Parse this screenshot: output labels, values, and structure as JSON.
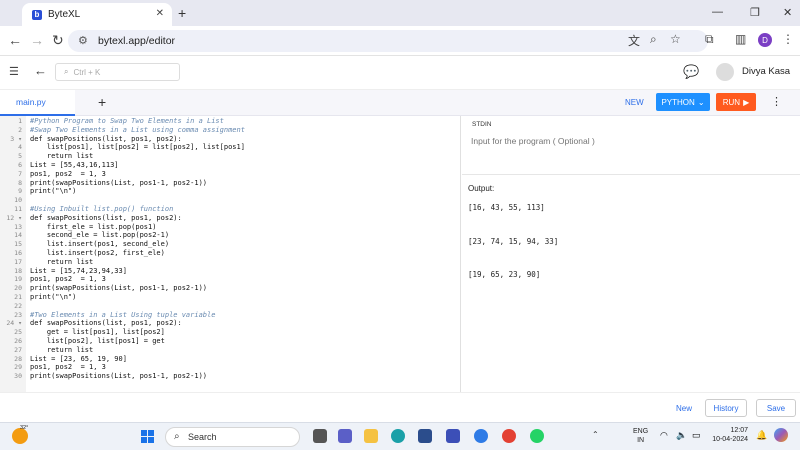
{
  "browser": {
    "tab_title": "ByteXL",
    "url": "bytexl.app/editor"
  },
  "app": {
    "search_placeholder": "Ctrl + K",
    "user_name": "Divya Kasa",
    "avatar_initial": "D"
  },
  "toolbar": {
    "file_tab": "main.py",
    "new_label": "NEW",
    "language_label": "PYTHON",
    "run_label": "RUN"
  },
  "editor": {
    "lines": [
      {
        "n": "1",
        "text": "#Python Program to Swap Two Elements in a List",
        "cls": "cm"
      },
      {
        "n": "2",
        "text": "#Swap Two Elements in a List using comma assignment",
        "cls": "cm"
      },
      {
        "n": "3 ▾",
        "text": "def swapPositions(list, pos1, pos2):",
        "cls": "kw"
      },
      {
        "n": "4",
        "text": "    list[pos1], list[pos2] = list[pos2], list[pos1]",
        "cls": ""
      },
      {
        "n": "5",
        "text": "    return list",
        "cls": ""
      },
      {
        "n": "6",
        "text": "List = [55,43,16,113]",
        "cls": ""
      },
      {
        "n": "7",
        "text": "pos1, pos2  = 1, 3",
        "cls": ""
      },
      {
        "n": "8",
        "text": "print(swapPositions(List, pos1-1, pos2-1))",
        "cls": ""
      },
      {
        "n": "9",
        "text": "print(\"\\n\")",
        "cls": ""
      },
      {
        "n": "10",
        "text": "",
        "cls": ""
      },
      {
        "n": "11",
        "text": "#Using Inbuilt list.pop() function",
        "cls": "cm"
      },
      {
        "n": "12 ▾",
        "text": "def swapPositions(list, pos1, pos2):",
        "cls": "kw"
      },
      {
        "n": "13",
        "text": "    first_ele = list.pop(pos1)",
        "cls": ""
      },
      {
        "n": "14",
        "text": "    second_ele = list.pop(pos2-1)",
        "cls": ""
      },
      {
        "n": "15",
        "text": "    list.insert(pos1, second_ele)",
        "cls": ""
      },
      {
        "n": "16",
        "text": "    list.insert(pos2, first_ele)",
        "cls": ""
      },
      {
        "n": "17",
        "text": "    return list",
        "cls": ""
      },
      {
        "n": "18",
        "text": "List = [15,74,23,94,33]",
        "cls": ""
      },
      {
        "n": "19",
        "text": "pos1, pos2  = 1, 3",
        "cls": ""
      },
      {
        "n": "20",
        "text": "print(swapPositions(List, pos1-1, pos2-1))",
        "cls": ""
      },
      {
        "n": "21",
        "text": "print(\"\\n\")",
        "cls": ""
      },
      {
        "n": "22",
        "text": "",
        "cls": ""
      },
      {
        "n": "23",
        "text": "#Two Elements in a List Using tuple variable",
        "cls": "cm"
      },
      {
        "n": "24 ▾",
        "text": "def swapPositions(list, pos1, pos2):",
        "cls": "kw"
      },
      {
        "n": "25",
        "text": "    get = list[pos1], list[pos2]",
        "cls": ""
      },
      {
        "n": "26",
        "text": "    list[pos2], list[pos1] = get",
        "cls": ""
      },
      {
        "n": "27",
        "text": "    return list",
        "cls": ""
      },
      {
        "n": "28",
        "text": "List = [23, 65, 19, 90]",
        "cls": ""
      },
      {
        "n": "29",
        "text": "pos1, pos2  = 1, 3",
        "cls": ""
      },
      {
        "n": "30",
        "text": "print(swapPositions(List, pos1-1, pos2-1))",
        "cls": ""
      }
    ]
  },
  "stdin": {
    "label": "STDIN",
    "placeholder": "Input for the program ( Optional )"
  },
  "output": {
    "label": "Output:",
    "lines": [
      "[16, 43, 55, 113]",
      "[23, 74, 15, 94, 33]",
      "[19, 65, 23, 90]"
    ]
  },
  "bottom": {
    "new_label": "New",
    "history_label": "History",
    "save_label": "Save"
  },
  "taskbar": {
    "temperature": "32°",
    "search_label": "Search",
    "lang_top": "ENG",
    "lang_bottom": "IN",
    "time": "12:07",
    "date": "10-04-2024"
  }
}
